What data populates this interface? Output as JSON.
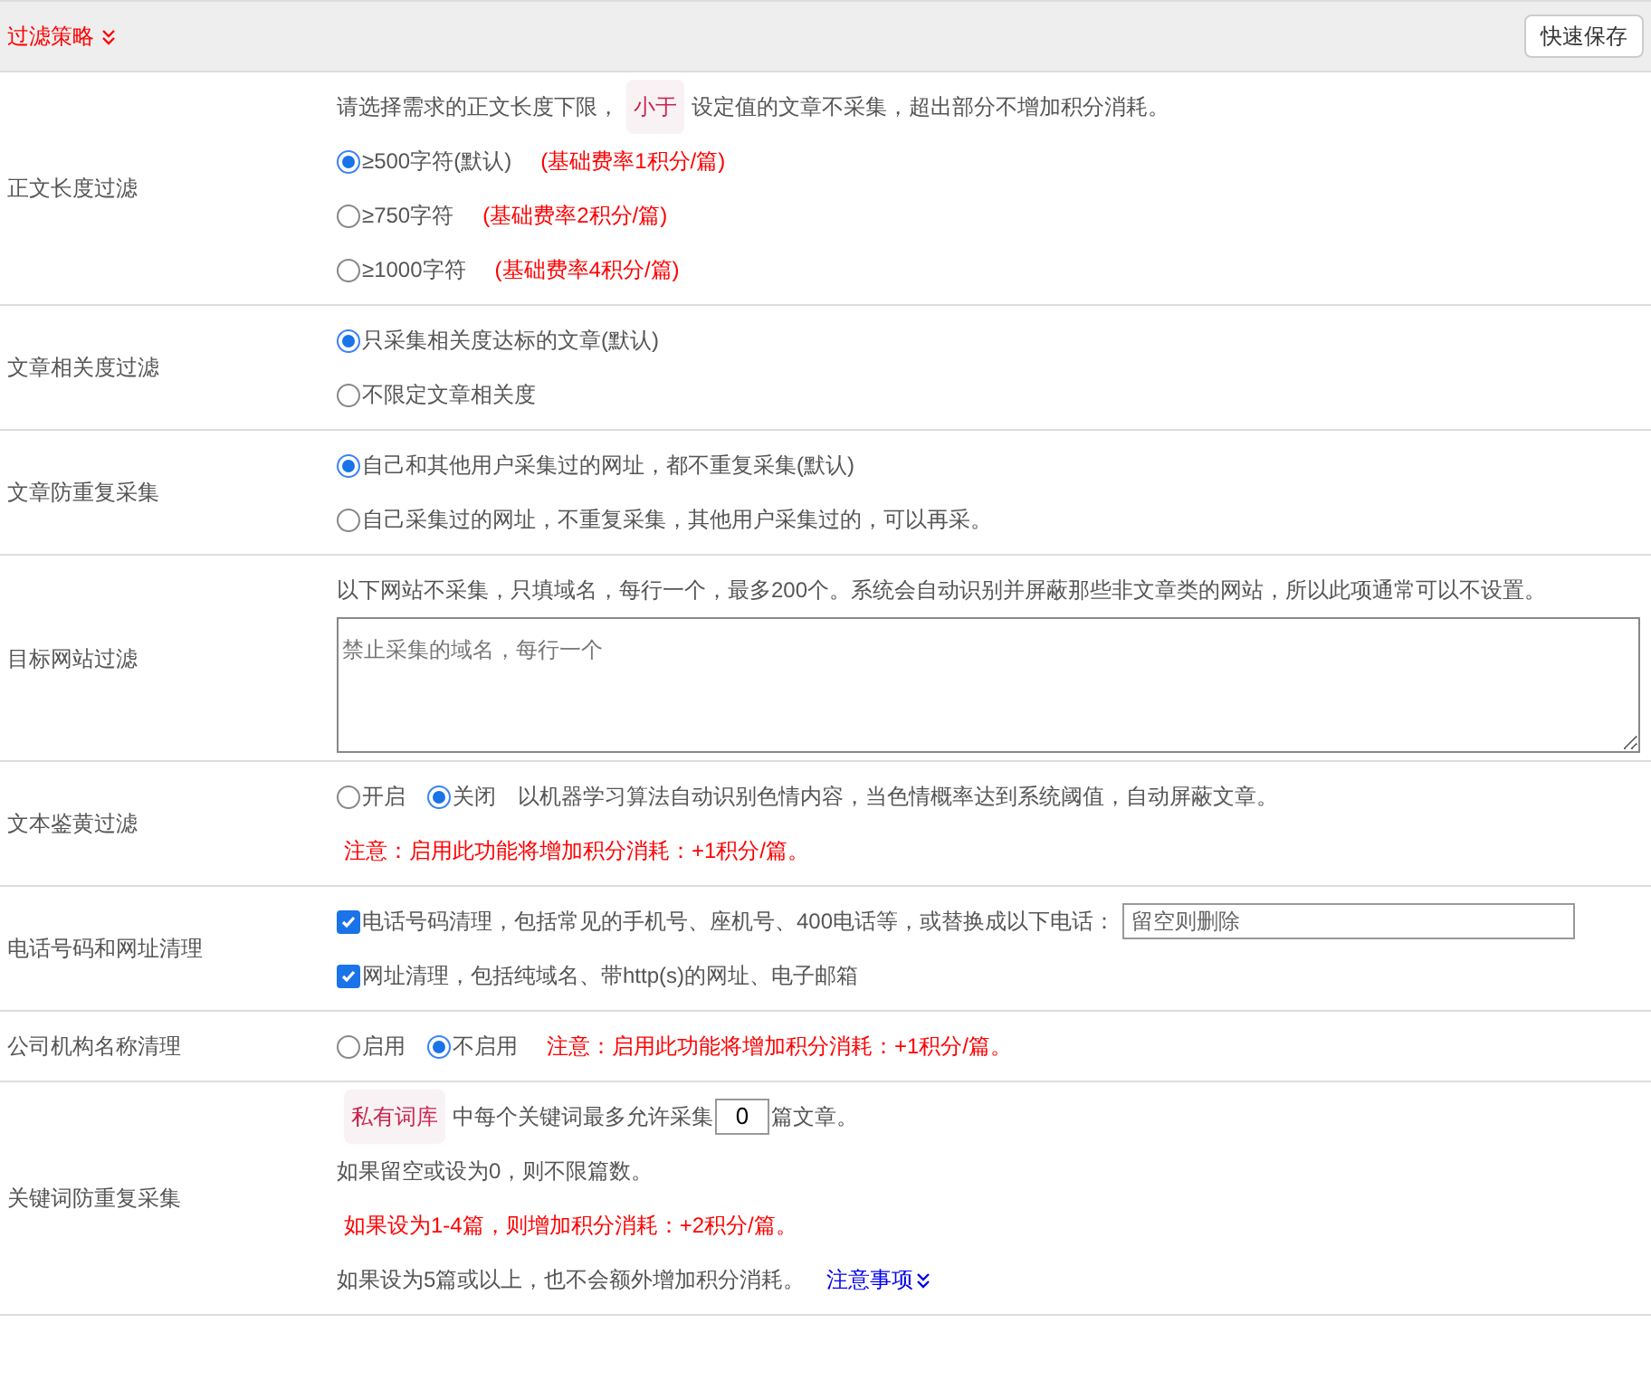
{
  "header": {
    "title": "过滤策略",
    "save_button": "快速保存"
  },
  "rows": [
    {
      "label": "正文长度过滤",
      "lines": [
        [
          {
            "kind": "text",
            "text": "请选择需求的正文长度下限，"
          },
          {
            "kind": "tag",
            "text": "小于"
          },
          {
            "kind": "text",
            "text": "设定值的文章不采集，超出部分不增加积分消耗。"
          }
        ],
        [
          {
            "kind": "radio",
            "text": "≥500字符(默认)",
            "selected": true
          },
          {
            "kind": "red",
            "text": "(基础费率1积分/篇)"
          }
        ],
        [
          {
            "kind": "radio",
            "text": "≥750字符",
            "selected": false
          },
          {
            "kind": "red",
            "text": "(基础费率2积分/篇)"
          }
        ],
        [
          {
            "kind": "radio",
            "text": "≥1000字符",
            "selected": false
          },
          {
            "kind": "red",
            "text": "(基础费率4积分/篇)"
          }
        ]
      ]
    },
    {
      "label": "文章相关度过滤",
      "lines": [
        [
          {
            "kind": "radio",
            "text": "只采集相关度达标的文章(默认)",
            "selected": true
          }
        ],
        [
          {
            "kind": "radio",
            "text": "不限定文章相关度",
            "selected": false
          }
        ]
      ]
    },
    {
      "label": "文章防重复采集",
      "lines": [
        [
          {
            "kind": "radio",
            "text": "自己和其他用户采集过的网址，都不重复采集(默认)",
            "selected": true
          }
        ],
        [
          {
            "kind": "radio",
            "text": "自己采集过的网址，不重复采集，其他用户采集过的，可以再采。",
            "selected": false
          }
        ]
      ]
    },
    {
      "label": "目标网站过滤",
      "lines": [
        [
          {
            "kind": "text",
            "text": "以下网站不采集，只填域名，每行一个，最多200个。系统会自动识别并屏蔽那些非文章类的网站，所以此项通常可以不设置。"
          }
        ],
        [
          {
            "kind": "textarea",
            "placeholder": "禁止采集的域名，每行一个"
          }
        ]
      ]
    },
    {
      "label": "文本鉴黄过滤",
      "lines": [
        [
          {
            "kind": "radio",
            "text": "开启",
            "selected": false
          },
          {
            "kind": "radio",
            "text": "关闭",
            "selected": true
          },
          {
            "kind": "text",
            "text": "以机器学习算法自动识别色情内容，当色情概率达到系统阈值，自动屏蔽文章。"
          }
        ],
        [
          {
            "kind": "red",
            "text": "注意：启用此功能将增加积分消耗：+1积分/篇。"
          }
        ]
      ]
    },
    {
      "label": "电话号码和网址清理",
      "lines": [
        [
          {
            "kind": "checkbox",
            "text": "电话号码清理，包括常见的手机号、座机号、400电话等，或替换成以下电话：",
            "checked": true
          },
          {
            "kind": "input",
            "placeholder": "留空则删除"
          }
        ],
        [
          {
            "kind": "checkbox",
            "text": "网址清理，包括纯域名、带http(s)的网址、电子邮箱",
            "checked": true
          }
        ]
      ]
    },
    {
      "label": "公司机构名称清理",
      "lines": [
        [
          {
            "kind": "radio",
            "text": "启用",
            "selected": false
          },
          {
            "kind": "radio",
            "text": "不启用",
            "selected": true
          },
          {
            "kind": "red",
            "text": "注意：启用此功能将增加积分消耗：+1积分/篇。"
          }
        ]
      ]
    },
    {
      "label": "关键词防重复采集",
      "lines": [
        [
          {
            "kind": "tag",
            "text": "私有词库"
          },
          {
            "kind": "text",
            "text": "中每个关键词最多允许采集"
          },
          {
            "kind": "number",
            "value": "0"
          },
          {
            "kind": "text",
            "text": "篇文章。"
          }
        ],
        [
          {
            "kind": "text",
            "text": "如果留空或设为0，则不限篇数。"
          }
        ],
        [
          {
            "kind": "red",
            "text": "如果设为1-4篇，则增加积分消耗：+2积分/篇。"
          }
        ],
        [
          {
            "kind": "text",
            "text": "如果设为5篇或以上，也不会额外增加积分消耗。"
          },
          {
            "kind": "link",
            "text": "注意事项"
          }
        ]
      ]
    }
  ]
}
